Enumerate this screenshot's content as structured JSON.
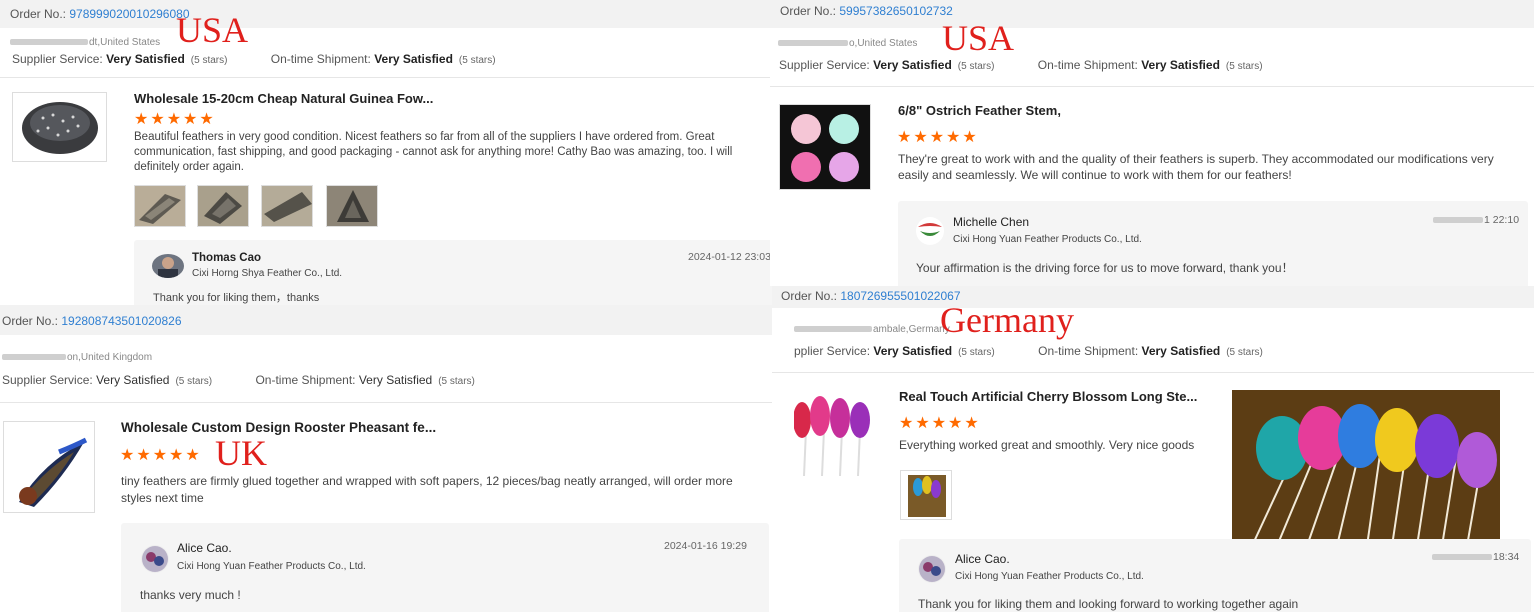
{
  "colors": {
    "star": "#ff6a00",
    "order_link": "#2f7fd1",
    "country_label": "#e0201c"
  },
  "panels": [
    {
      "order_label": "Order No.:",
      "order_number": "978999020010296080",
      "location": "dt,United States",
      "supplier_label": "Supplier Service:",
      "supplier_value": "Very Satisfied",
      "supplier_stars": "(5 stars)",
      "shipment_label": "On-time Shipment:",
      "shipment_value": "Very Satisfied",
      "shipment_stars": "(5 stars)",
      "country": "USA",
      "product_title": "Wholesale 15-20cm Cheap Natural Guinea Fow...",
      "stars": "★★★★★",
      "comment": "Beautiful feathers in very good condition.  Nicest feathers so far from all of the suppliers I have ordered from.  Great communication, fast shipping, and good packaging - cannot ask for anything more!  Cathy Bao was amazing, too.  I will definitely order again.",
      "reply_name": "Thomas Cao",
      "reply_company": "Cixi Horng Shya Feather Co., Ltd.",
      "reply_time": "2024-01-12 23:03",
      "reply_text": "Thank you for liking them，thanks"
    },
    {
      "order_label": "Order No.:",
      "order_number": "59957382650102732",
      "location": "o,United States",
      "supplier_label": "Supplier Service:",
      "supplier_value": "Very Satisfied",
      "supplier_stars": "(5 stars)",
      "shipment_label": "On-time Shipment:",
      "shipment_value": "Very Satisfied",
      "shipment_stars": "(5 stars)",
      "country": "USA",
      "product_title": "6/8\" Ostrich Feather Stem,",
      "stars": "★★★★★",
      "comment": "They're great to work with and the quality of their feathers is superb.  They accommodated our modifications very easily and seamlessly.  We will continue to work with them for our feathers!",
      "reply_name": "Michelle Chen",
      "reply_company": "Cixi Hong Yuan Feather Products Co., Ltd.",
      "reply_time": "1 22:10",
      "reply_text": "Your affirmation is the driving force for us to move forward, thank you！"
    },
    {
      "order_label": "Order No.:",
      "order_number": "192808743501020826",
      "location": "on,United Kingdom",
      "supplier_label": "Supplier Service:",
      "supplier_value": "Very Satisfied",
      "supplier_stars": "(5 stars)",
      "shipment_label": "On-time Shipment:",
      "shipment_value": "Very Satisfied",
      "shipment_stars": "(5 stars)",
      "country": "UK",
      "product_title": "Wholesale Custom Design Rooster Pheasant fe...",
      "stars": "★★★★★",
      "comment": "tiny feathers are firmly glued together and wrapped with soft papers, 12 pieces/bag neatly arranged, will order more styles next time",
      "reply_name": "Alice Cao.",
      "reply_company": "Cixi Hong Yuan Feather Products Co., Ltd.",
      "reply_time": "2024-01-16 19:29",
      "reply_text": "thanks very much !"
    },
    {
      "order_label": "Order No.:",
      "order_number": "180726955501022067",
      "location": "ambale,Germany",
      "supplier_label": "pplier Service:",
      "supplier_value": "Very Satisfied",
      "supplier_stars": "(5 stars)",
      "shipment_label": "On-time Shipment:",
      "shipment_value": "Very Satisfied",
      "shipment_stars": "(5 stars)",
      "country": "Germany",
      "product_title": "Real Touch Artificial Cherry Blossom Long Ste...",
      "stars": "★★★★★",
      "comment": "Everything worked great and smoothly. Very nice goods",
      "reply_name": "Alice Cao.",
      "reply_company": "Cixi Hong Yuan Feather Products Co., Ltd.",
      "reply_time": "18:34",
      "reply_text": "Thank you for liking them and looking forward to working together again"
    }
  ]
}
